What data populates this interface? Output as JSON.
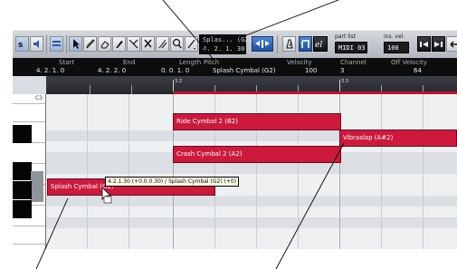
{
  "toolbar": {
    "note_lcd": {
      "line1": "Splas... (G2)",
      "line2": "4. 2. 1. 30"
    },
    "event_letter": "el",
    "part_list_label": "part list",
    "part_list_value": "MIDI 03",
    "ins_vel_label": "ins. vel.",
    "ins_vel_value": "100"
  },
  "info_line": {
    "headers": {
      "start": "Start",
      "end": "End",
      "length": "Length",
      "pitch": "Pitch",
      "velocity": "Velocity",
      "channel": "Channel",
      "off_velocity": "Off Velocity"
    },
    "values": {
      "start": "4. 2. 1.   0",
      "end": "4. 2. 2.   0",
      "length": "0. 0. 1.   0",
      "pitch": "Splash Cymbal (G2)",
      "velocity": "100",
      "channel": "3",
      "off_velocity": "64"
    }
  },
  "ruler": {
    "label_1": "3.2",
    "label_2": "3.3"
  },
  "keyboard": {
    "c3_label": "C3"
  },
  "events": [
    {
      "label": "Ride Cymbal 2 (B2)"
    },
    {
      "label": "Vibraslap (A#2)"
    },
    {
      "label": "Crash Cymbal 2 (A2)"
    },
    {
      "label": "Splash Cymbal (G2)"
    }
  ],
  "tooltip": "4.2.1.30 (+0.0.0.30) / Splash Cymbal (G2) (+0)",
  "colors": {
    "event": "#cd1a3c",
    "accent_blue": "#1c4fa0"
  }
}
